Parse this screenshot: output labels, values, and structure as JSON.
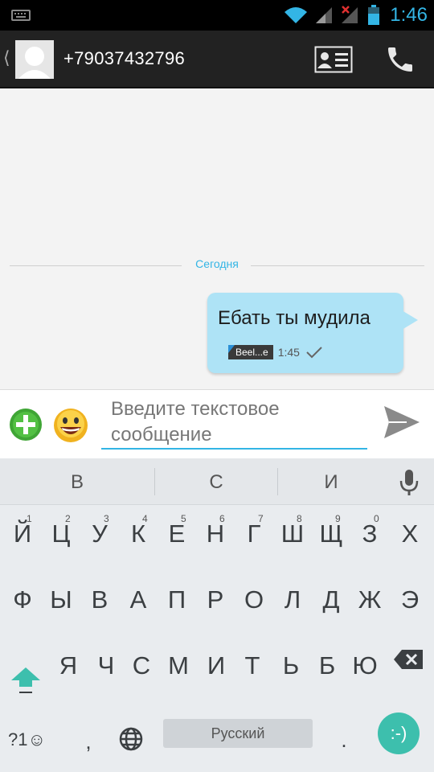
{
  "status_bar": {
    "time": "1:46"
  },
  "header": {
    "phone_number": "+79037432796",
    "back_icon": "chevron-left-icon",
    "contact_card_icon": "contact-card-icon",
    "call_icon": "phone-icon"
  },
  "conversation": {
    "date_label": "Сегодня",
    "messages": [
      {
        "text": "Ебать ты мудила",
        "sim_label": "Beel...e",
        "time": "1:45",
        "status_icon": "checkmark-icon"
      }
    ]
  },
  "compose": {
    "placeholder": "Введите текстовое сообщение",
    "attach_icon": "plus-circle-icon",
    "emoji_icon": "smiley-emoji-icon",
    "send_icon": "send-icon"
  },
  "keyboard": {
    "suggestions": [
      "в",
      "с",
      "и"
    ],
    "row1": [
      {
        "key": "й",
        "hint": "1"
      },
      {
        "key": "ц",
        "hint": "2"
      },
      {
        "key": "у",
        "hint": "3"
      },
      {
        "key": "к",
        "hint": "4"
      },
      {
        "key": "е",
        "hint": "5"
      },
      {
        "key": "н",
        "hint": "6"
      },
      {
        "key": "г",
        "hint": "7"
      },
      {
        "key": "ш",
        "hint": "8"
      },
      {
        "key": "щ",
        "hint": "9"
      },
      {
        "key": "з",
        "hint": "0"
      },
      {
        "key": "х",
        "hint": ""
      }
    ],
    "row2": [
      "ф",
      "ы",
      "в",
      "а",
      "п",
      "р",
      "о",
      "л",
      "д",
      "ж",
      "э"
    ],
    "row3": [
      "я",
      "ч",
      "с",
      "м",
      "и",
      "т",
      "ь",
      "б",
      "ю"
    ],
    "symbols_label": "?1☺",
    "comma": ",",
    "space_label": "Русский",
    "period": ".",
    "smiley_label": ":-)",
    "accent_color": "#33b5e5",
    "bubble_color": "#aee3f6",
    "smiley_key_color": "#3dbfad"
  }
}
